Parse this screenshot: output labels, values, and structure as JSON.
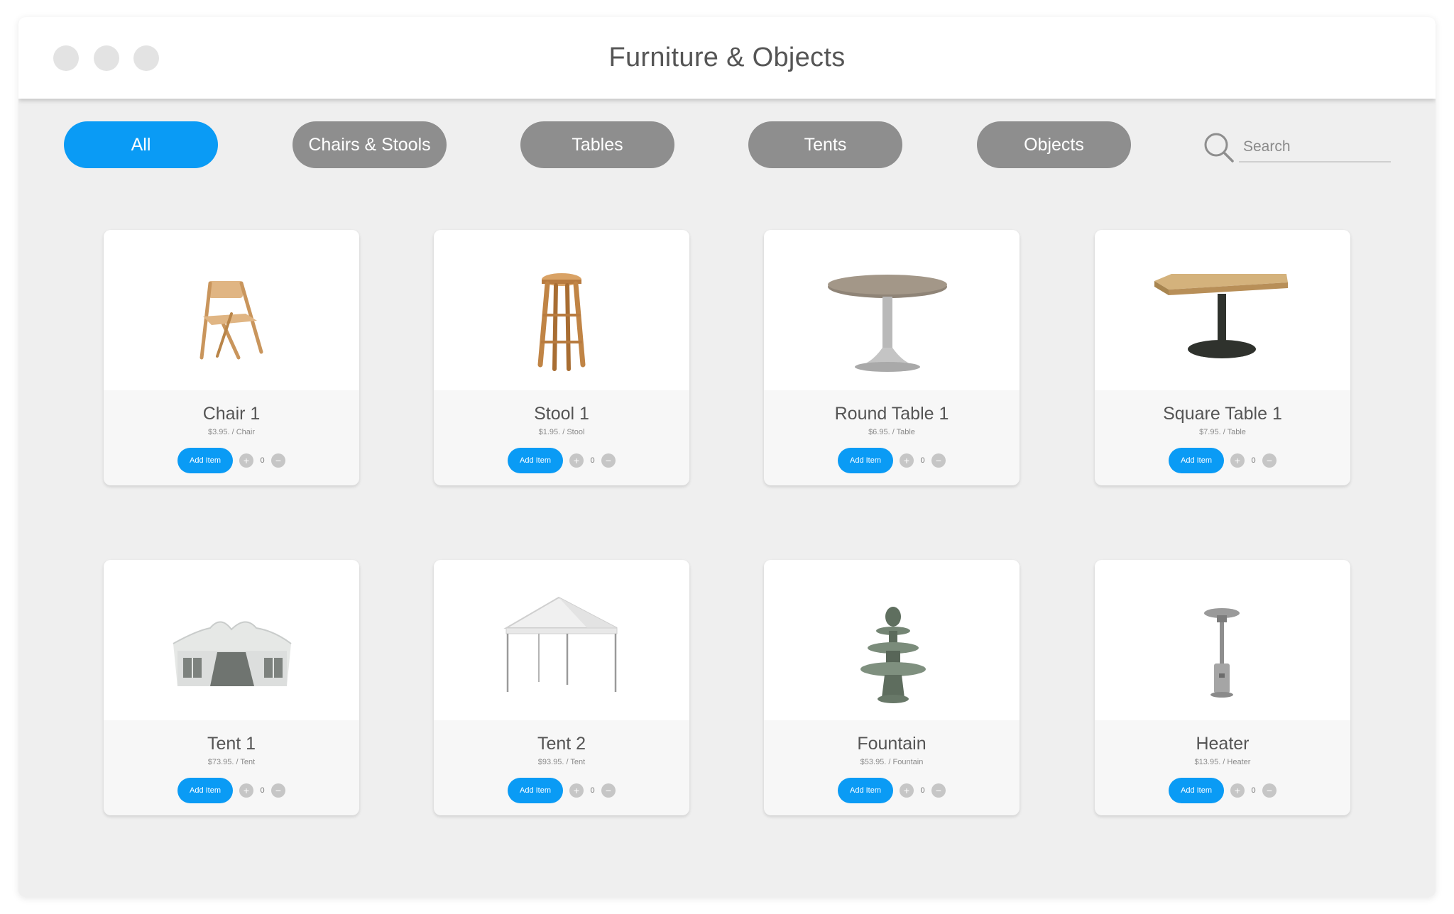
{
  "window": {
    "title": "Furniture & Objects"
  },
  "filters": [
    {
      "label": "All",
      "active": true
    },
    {
      "label": "Chairs & Stools",
      "active": false
    },
    {
      "label": "Tables",
      "active": false
    },
    {
      "label": "Tents",
      "active": false
    },
    {
      "label": "Objects",
      "active": false
    }
  ],
  "search": {
    "placeholder": "Search",
    "value": ""
  },
  "products": [
    {
      "name": "Chair 1",
      "price": "$3.95. / Chair",
      "add_label": "Add Item",
      "quantity": "0",
      "icon": "folding-chair-image"
    },
    {
      "name": "Stool 1",
      "price": "$1.95. / Stool",
      "add_label": "Add Item",
      "quantity": "0",
      "icon": "bar-stool-image"
    },
    {
      "name": "Round Table 1",
      "price": "$6.95. / Table",
      "add_label": "Add Item",
      "quantity": "0",
      "icon": "round-table-image"
    },
    {
      "name": "Square Table 1",
      "price": "$7.95. / Table",
      "add_label": "Add Item",
      "quantity": "0",
      "icon": "square-table-image"
    },
    {
      "name": "Tent 1",
      "price": "$73.95. / Tent",
      "add_label": "Add Item",
      "quantity": "0",
      "icon": "tent-image"
    },
    {
      "name": "Tent 2",
      "price": "$93.95. / Tent",
      "add_label": "Add Item",
      "quantity": "0",
      "icon": "canopy-tent-image"
    },
    {
      "name": "Fountain",
      "price": "$53.95. / Fountain",
      "add_label": "Add Item",
      "quantity": "0",
      "icon": "fountain-image"
    },
    {
      "name": "Heater",
      "price": "$13.95. / Heater",
      "add_label": "Add Item",
      "quantity": "0",
      "icon": "patio-heater-image"
    }
  ],
  "colors": {
    "accent": "#0a9bf5",
    "pill_inactive": "#8e8e8e",
    "background": "#efefef",
    "card": "#f7f7f7"
  }
}
